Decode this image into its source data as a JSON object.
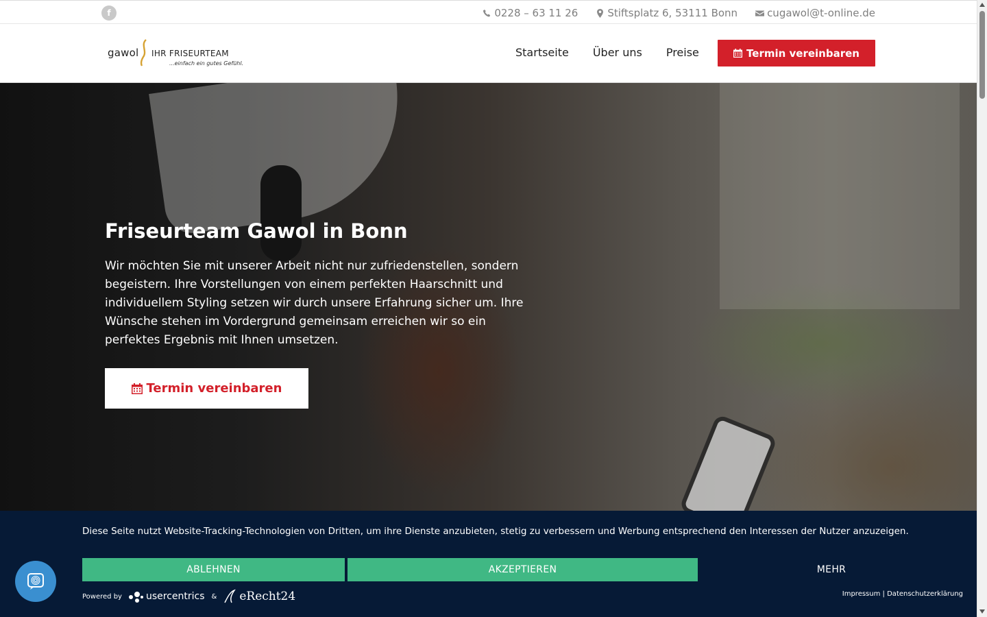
{
  "topbar": {
    "facebook_icon": "facebook-icon",
    "phone": "0228 – 63 11 26",
    "address": "Stiftsplatz 6, 53111 Bonn",
    "email": "cugawol@t-online.de"
  },
  "header": {
    "logo": {
      "brand": "gawol",
      "team": "IHR FRISEURTEAM",
      "slogan": "...einfach ein gutes Gefühl."
    },
    "nav": [
      "Startseite",
      "Über uns",
      "Preise"
    ],
    "cta_label": "Termin vereinbaren"
  },
  "hero": {
    "title": "Friseurteam Gawol in Bonn",
    "text": "Wir möchten Sie mit unserer Arbeit nicht nur zufriedenstellen, sondern begeistern. Ihre Vorstellungen von einem perfekten Haarschnitt und individuellem Styling setzen wir durch unsere Erfahrung sicher um. Ihre Wünsche stehen im Vordergrund gemeinsam erreichen wir so ein perfektes Ergebnis mit Ihnen umsetzen.",
    "cta_label": "Termin vereinbaren"
  },
  "cookie_banner": {
    "text": "Diese Seite nutzt Website-Tracking-Technologien von Dritten, um ihre Dienste anzubieten, stetig zu verbessern und Werbung entsprechend den Interessen der Nutzer anzuzeigen.",
    "decline_label": "ABLEHNEN",
    "accept_label": "AKZEPTIEREN",
    "more_label": "MEHR",
    "powered_by": "Powered by",
    "usercentrics": "usercentrics",
    "ampersand": "&",
    "erecht": "eRecht24",
    "impressum": "Impressum",
    "separator": "|",
    "privacy": "Datenschutzerklärung"
  },
  "colors": {
    "accent_red": "#d3202a",
    "banner_bg": "#061a36",
    "consent_green": "#40b884",
    "privacy_button": "#3a8fd0"
  }
}
